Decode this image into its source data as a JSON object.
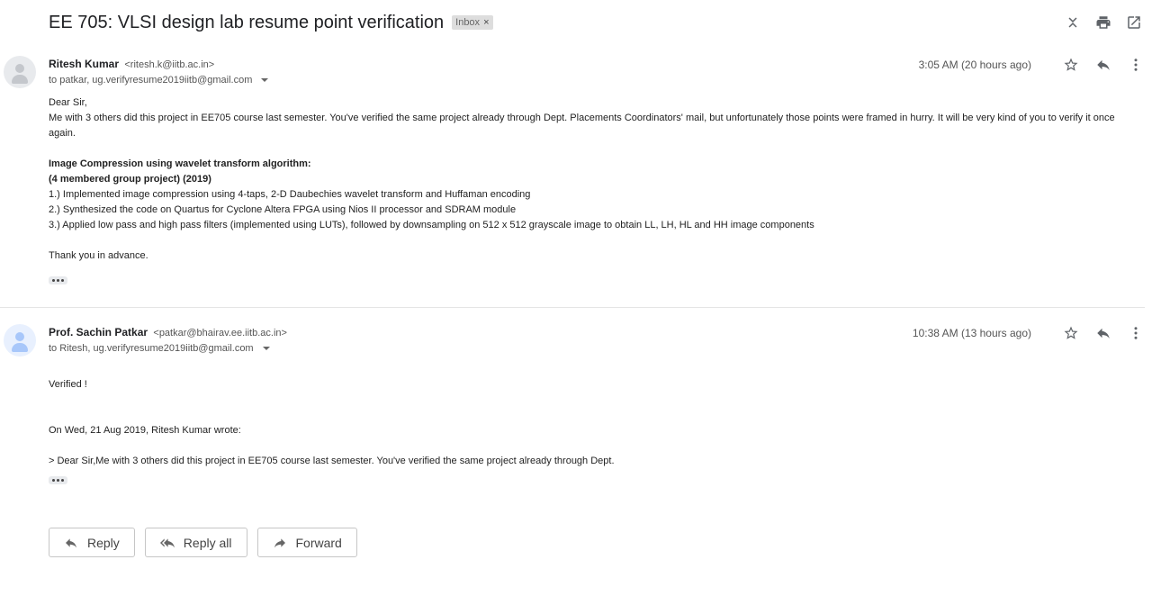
{
  "thread": {
    "subject": "EE 705: VLSI design lab resume point verification",
    "label": "Inbox",
    "label_remove": "×"
  },
  "top_actions": [
    "collapse-all-icon",
    "print-icon",
    "open-in-new-window-icon"
  ],
  "messages": [
    {
      "sender_name": "Ritesh Kumar",
      "sender_email": "<ritesh.k@iitb.ac.in>",
      "to": "to patkar, ug.verifyresume2019iitb@gmail.com",
      "time": "3:05 AM (20 hours ago)",
      "body": {
        "greeting": "Dear Sir,",
        "paragraph": "Me with 3 others did this project in EE705 course last semester. You've verified the same project already through Dept. Placements Coordinators' mail, but unfortunately those points were framed in hurry. It will be very kind of you to verify it once again.",
        "project_title": "Image Compression using wavelet transform algorithm:",
        "project_group": "(4 membered group project) (2019)",
        "points": [
          "1.)  Implemented image compression using 4-taps, 2-D Daubechies wavelet transform and Huffaman encoding",
          "2.) Synthesized the code on Quartus for Cyclone Altera FPGA using Nios II processor and SDRAM module",
          "3.)  Applied low pass and high pass filters (implemented using LUTs), followed by downsampling on 512 x 512 grayscale image to obtain LL, LH, HL and HH image components"
        ],
        "closing": "Thank you in advance."
      }
    },
    {
      "sender_name": "Prof. Sachin Patkar",
      "sender_email": "<patkar@bhairav.ee.iitb.ac.in>",
      "to": "to Ritesh, ug.verifyresume2019iitb@gmail.com",
      "time": "10:38 AM (13 hours ago)",
      "body": {
        "text": "Verified !",
        "quote_header": "On Wed, 21 Aug 2019, Ritesh Kumar wrote:",
        "quote": "> Dear Sir,Me with 3 others did this project in EE705 course last semester. You've verified the same project already through Dept."
      }
    }
  ],
  "reply_actions": {
    "reply": "Reply",
    "reply_all": "Reply all",
    "forward": "Forward"
  }
}
